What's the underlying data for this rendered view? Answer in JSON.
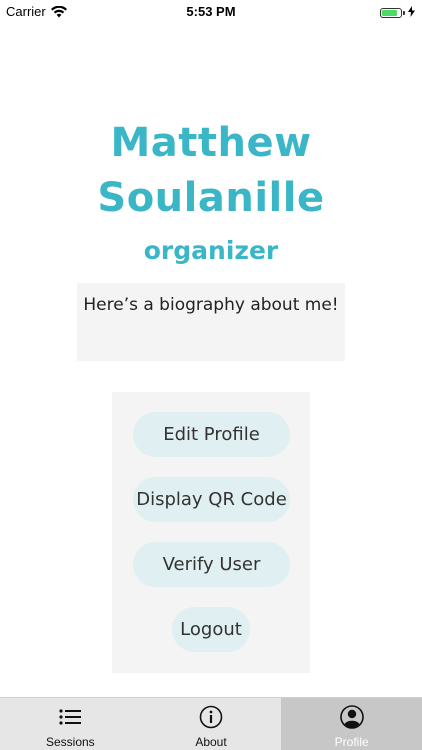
{
  "status_bar": {
    "carrier": "Carrier",
    "time": "5:53 PM",
    "battery_level": 0.85,
    "battery_color": "#4cd964"
  },
  "profile": {
    "name_line1": "Matthew",
    "name_line2": "Soulanille",
    "role": "organizer",
    "bio": "Here’s a biography about me!",
    "accent_color": "#3ab6c7"
  },
  "actions": {
    "edit_profile": "Edit Profile",
    "display_qr": "Display QR Code",
    "verify_user": "Verify User",
    "logout": "Logout"
  },
  "tab_bar": {
    "tabs": [
      {
        "label": "Sessions",
        "icon": "list-icon",
        "selected": false
      },
      {
        "label": "About",
        "icon": "info-icon",
        "selected": false
      },
      {
        "label": "Profile",
        "icon": "profile-icon",
        "selected": true
      }
    ]
  }
}
